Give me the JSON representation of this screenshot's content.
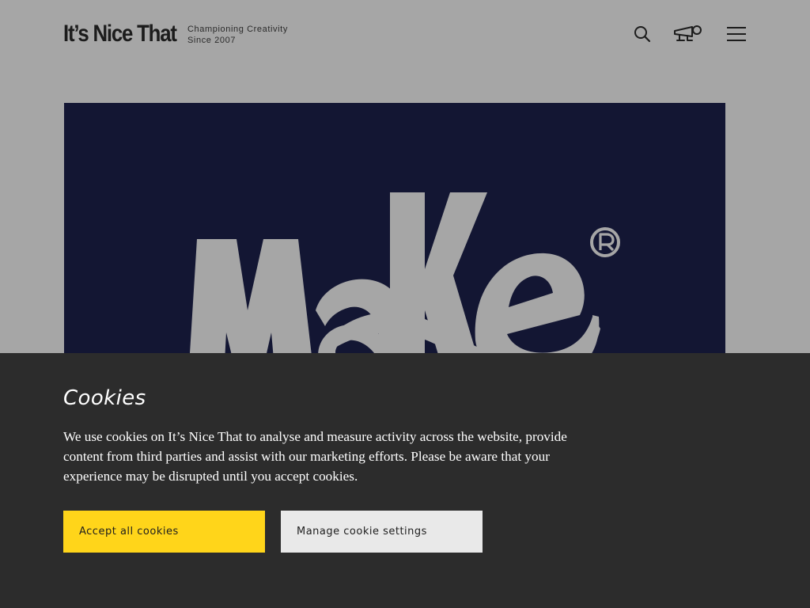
{
  "header": {
    "logo_text": "It’s Nice That",
    "tagline_line1": "Championing Creativity",
    "tagline_line2": "Since 2007",
    "icons": [
      "search-icon",
      "megaphone-icon",
      "menu-icon"
    ]
  },
  "hero": {
    "image_text": "Make",
    "background_color": "#131633",
    "letter_color": "#a6a6a6"
  },
  "cookie_banner": {
    "title": "Cookies",
    "body": "We use cookies on It’s Nice That to analyse and measure activity across the website, provide content from third parties and assist with our marketing efforts. Please be aware that your experience may be disrupted until you accept cookies.",
    "accept_label": "Accept all cookies",
    "manage_label": "Manage cookie settings",
    "accept_color": "#ffd51a",
    "manage_color": "#e9e9e9",
    "background_color": "#2c2c2c"
  }
}
